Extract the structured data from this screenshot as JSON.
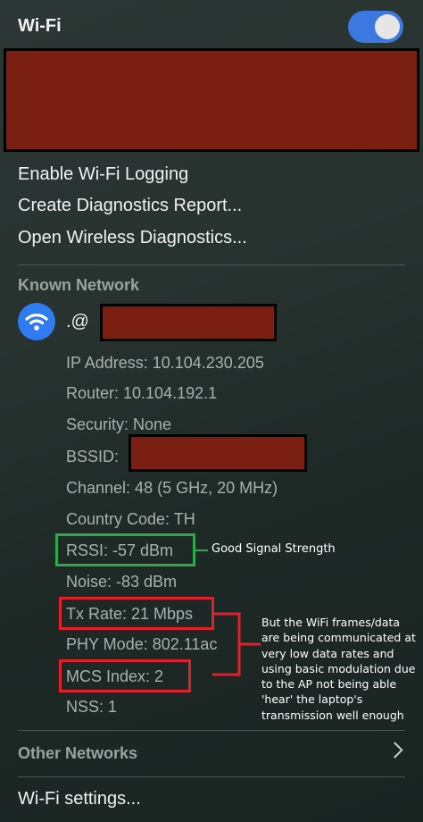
{
  "header": {
    "title": "Wi-Fi",
    "toggle_on": true,
    "toggle_color": "#3b78e0"
  },
  "menu": [
    {
      "label": "Enable Wi-Fi Logging"
    },
    {
      "label": "Create Diagnostics Report..."
    },
    {
      "label": "Open Wireless Diagnostics..."
    }
  ],
  "known_network": {
    "heading": "Known Network",
    "icon": "wifi-icon",
    "ssid_prefix": ".@",
    "details": {
      "ip": "IP Address: 10.104.230.205",
      "router": "Router: 10.104.192.1",
      "security": "Security: None",
      "bssid_label": "BSSID:",
      "channel": "Channel: 48 (5 GHz, 20 MHz)",
      "country": "Country Code: TH",
      "rssi": "RSSI: -57 dBm",
      "noise": "Noise: -83 dBm",
      "tx_rate": "Tx Rate: 21 Mbps",
      "phy_mode": "PHY Mode: 802.11ac",
      "mcs_index": "MCS Index: 2",
      "nss": "NSS: 1"
    }
  },
  "annotations": {
    "good_signal": "Good Signal Strength",
    "note_lines": [
      "But the WiFi frames/data",
      "are being communicated at",
      "very low data rates and",
      "using basic modulation due",
      "to the AP not being able",
      "'hear' the laptop's",
      "transmission  well enough"
    ],
    "green_color": "#2ea84c",
    "red_color": "#e0202a"
  },
  "other_networks": {
    "label": "Other Networks"
  },
  "footer": {
    "settings_label": "Wi-Fi settings..."
  },
  "redaction_color": "#7a1f12"
}
